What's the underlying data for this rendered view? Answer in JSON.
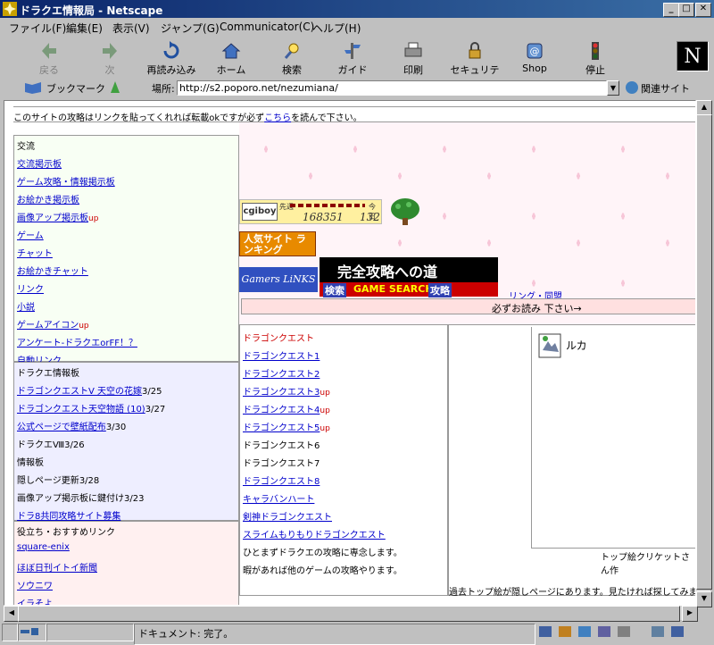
{
  "window": {
    "title": "ドラクエ情報局 - Netscape"
  },
  "menu": [
    "ファイル(F)",
    "編集(E)",
    "表示(V)",
    "ジャンプ(G)",
    "Communicator(C)",
    "ヘルプ(H)"
  ],
  "toolbar": {
    "back": "戻る",
    "forward": "次",
    "reload": "再読み込み",
    "home": "ホーム",
    "search": "検索",
    "guide": "ガイド",
    "print": "印刷",
    "security": "セキュリティ",
    "shop": "Shop",
    "stop": "停止"
  },
  "location": {
    "bookmarks": "ブックマーク",
    "label": "場所:",
    "url": "http://s2.poporo.net/nezumiana/",
    "related": "関連サイト"
  },
  "page": {
    "notice_pre": "このサイトの攻略はリンクを貼ってくれれば転載okですが必ず",
    "notice_link": "こちら",
    "notice_post": "を読んで下さい。",
    "left_sections": [
      {
        "title": "交流",
        "items": [
          {
            "text": "交流掲示板",
            "link": true,
            "suffix": ""
          },
          {
            "text": "ゲーム攻略・情報掲示板",
            "link": true,
            "suffix": ""
          },
          {
            "text": "お絵かき掲示板",
            "link": true,
            "suffix": ""
          },
          {
            "text": "画像アップ掲示板",
            "link": true,
            "suffix": "up"
          },
          {
            "text": "ゲーム",
            "link": true,
            "suffix": ""
          },
          {
            "text": "チャット",
            "link": true,
            "suffix": ""
          },
          {
            "text": "お絵かきチャット",
            "link": true,
            "suffix": ""
          },
          {
            "text": "リンク",
            "link": true,
            "suffix": ""
          },
          {
            "text": "小説",
            "link": true,
            "suffix": ""
          },
          {
            "text": "ゲームアイコン",
            "link": true,
            "suffix": "up"
          },
          {
            "text": "アンケート-ドラクエorFF！？",
            "link": true,
            "suffix": ""
          },
          {
            "text": "自動リンク",
            "link": true,
            "suffix": ""
          }
        ]
      },
      {
        "title": "ドラクエ情報板",
        "items": [
          {
            "text": "ドラゴンクエストV 天空の花嫁",
            "link": true,
            "suffix": "3/25"
          },
          {
            "text": "ドラゴンクエスト天空物語 (10)",
            "link": true,
            "suffix": "3/27"
          },
          {
            "text": "公式ページで壁紙配布",
            "link": true,
            "suffix": "3/30"
          },
          {
            "text": "ドラクエⅧ",
            "link": false,
            "suffix": "3/26"
          },
          {
            "text": "情報板",
            "link": false,
            "suffix": ""
          },
          {
            "text": "隠しページ更新",
            "link": false,
            "suffix": "3/28"
          },
          {
            "text": "画像アップ掲示板に鍵付け",
            "link": false,
            "suffix": "3/23"
          },
          {
            "text": "ドラ8共同攻略サイト募集",
            "link": true,
            "suffix": ""
          }
        ]
      },
      {
        "title": "役立ち・おすすめリンク",
        "items": [
          {
            "text": "square-enix",
            "link": true,
            "suffix": ""
          },
          {
            "text": "ほぼ日刊イトイ新聞",
            "link": true,
            "suffix": ""
          },
          {
            "text": "ソウニワ",
            "link": true,
            "suffix": ""
          },
          {
            "text": "イラそよ",
            "link": true,
            "suffix": ""
          }
        ]
      }
    ],
    "counter": {
      "logo": "cgiboy",
      "prev_label": "先週",
      "today_label": "今日",
      "total": "168351",
      "today": "132"
    },
    "banners": {
      "ranking": "人気サイト ランキング",
      "gamers": "Gamers LiNKS",
      "kanzen": "完全攻略への道",
      "kensaku": "検索",
      "gamesearch": "GAME SEARCH",
      "kouryaku": "攻略"
    },
    "ring": "リング・同盟",
    "must_read": "必ずお読み 下さい→",
    "dq_list": [
      {
        "text": "ドラゴンクエスト",
        "style": "red",
        "suffix": ""
      },
      {
        "text": "ドラゴンクエスト1",
        "style": "link",
        "suffix": ""
      },
      {
        "text": "ドラゴンクエスト2",
        "style": "link",
        "suffix": ""
      },
      {
        "text": "ドラゴンクエスト3",
        "style": "link",
        "suffix": "up"
      },
      {
        "text": "ドラゴンクエスト4",
        "style": "link",
        "suffix": "up"
      },
      {
        "text": "ドラゴンクエスト5",
        "style": "link",
        "suffix": "up"
      },
      {
        "text": "ドラゴンクエスト6",
        "style": "plain",
        "suffix": ""
      },
      {
        "text": "ドラゴンクエスト7",
        "style": "plain",
        "suffix": ""
      },
      {
        "text": "ドラゴンクエスト8",
        "style": "link",
        "suffix": ""
      },
      {
        "text": "キャラバンハート",
        "style": "link",
        "suffix": ""
      },
      {
        "text": "剣神ドラゴンクエスト",
        "style": "link",
        "suffix": ""
      },
      {
        "text": "スライムもりもりドラゴンクエスト",
        "style": "link",
        "suffix": ""
      },
      {
        "text": "ひとまずドラクエの攻略に専念します。",
        "style": "plain",
        "suffix": ""
      },
      {
        "text": "暇があれば他のゲームの攻略やります。",
        "style": "plain",
        "suffix": ""
      }
    ],
    "image_label": "ルカ",
    "credit": "トップ絵クリケットさん作",
    "bottom_note": "過去トップ絵が隠しページにあります。見たければ探してみましょう"
  },
  "status": {
    "text": "ドキュメント: 完了。"
  },
  "colors": {
    "titlebar": "#0a246a",
    "link": "#0000cc",
    "up": "#cc0000",
    "left_bg1": "#f8fff4",
    "left_bg2": "#eeeeff",
    "left_bg3": "#fff0f0"
  }
}
